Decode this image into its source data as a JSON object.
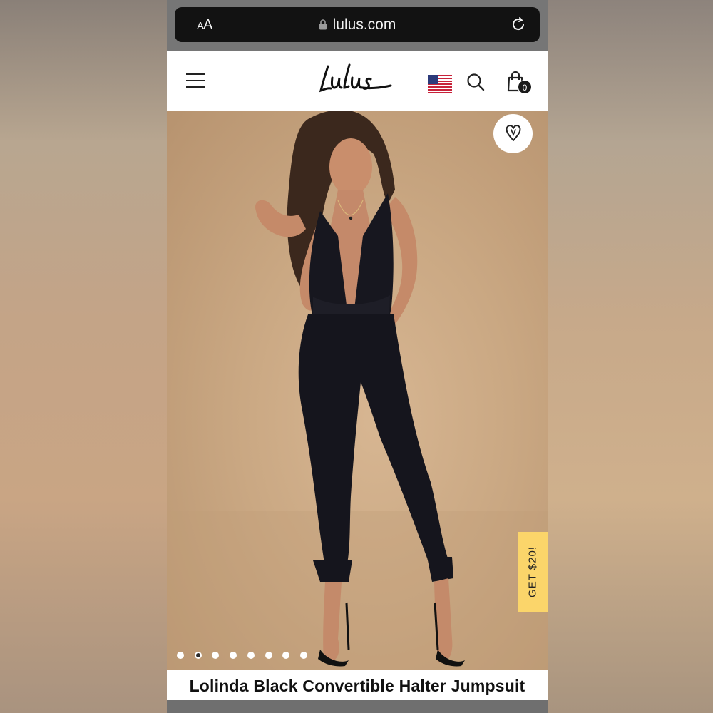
{
  "browser": {
    "text_size_button": "AA",
    "url": "lulus.com"
  },
  "header": {
    "logo_text": "Lulus",
    "bag_count": "0"
  },
  "product": {
    "title": "Lolinda Black Convertible Halter Jumpsuit",
    "promo_tab": "GET $20!",
    "carousel": {
      "total_slides": 8,
      "active_index": 1
    }
  },
  "icons": [
    "menu-icon",
    "us-flag-icon",
    "search-icon",
    "shopping-bag-icon",
    "heart-icon",
    "lock-icon",
    "reload-icon"
  ],
  "colors": {
    "header_bg": "#ffffff",
    "urlbar_bg": "#121212",
    "promo_tab_bg": "#fbd56a",
    "hero_bg": "#caa883"
  }
}
